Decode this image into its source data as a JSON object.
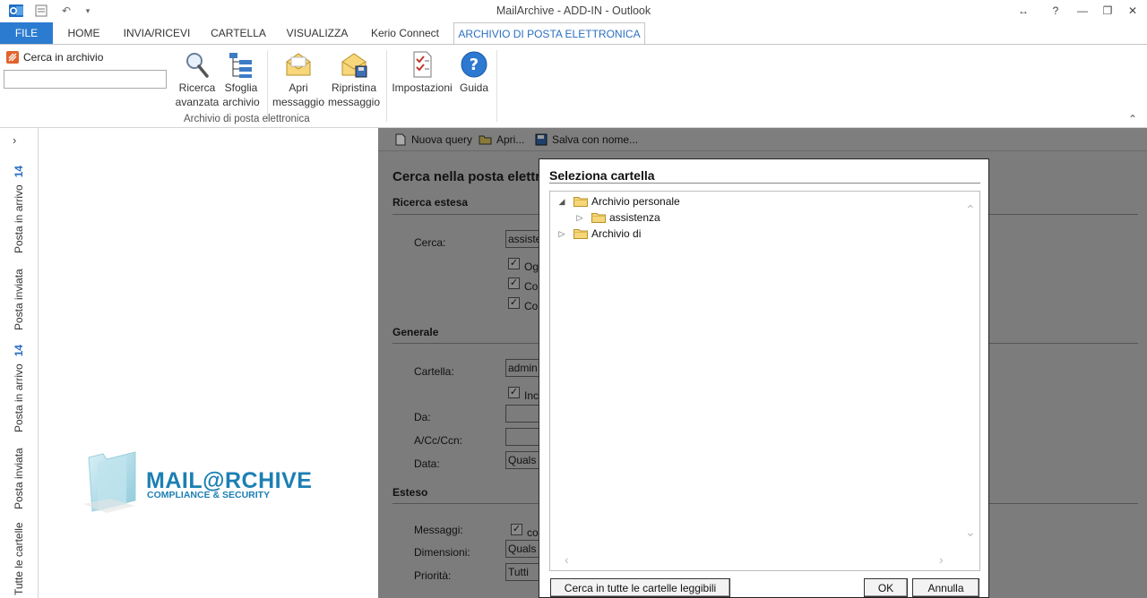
{
  "window": {
    "title": "MailArchive - ADD-IN - Outlook"
  },
  "tabs": [
    {
      "label": "FILE"
    },
    {
      "label": "HOME"
    },
    {
      "label": "INVIA/RICEVI"
    },
    {
      "label": "CARTELLA"
    },
    {
      "label": "VISUALIZZA"
    },
    {
      "label": "Kerio Connect"
    },
    {
      "label": "ARCHIVIO DI POSTA ELETTRONICA"
    }
  ],
  "ribbon": {
    "search_label": "Cerca in archivio",
    "search_value": "",
    "buttons": [
      {
        "line1": "Ricerca",
        "line2": "avanzata"
      },
      {
        "line1": "Sfoglia",
        "line2": "archivio"
      },
      {
        "line1": "Apri",
        "line2": "messaggio"
      },
      {
        "line1": "Ripristina",
        "line2": "messaggio"
      },
      {
        "line1": "Impostazioni",
        "line2": ""
      },
      {
        "line1": "Guida",
        "line2": ""
      }
    ],
    "group_label": "Archivio di posta elettronica"
  },
  "leftnav": {
    "items": [
      {
        "label": "Posta in arrivo",
        "count": "14"
      },
      {
        "label": "Posta inviata",
        "count": ""
      },
      {
        "label": "Posta in arrivo",
        "count": "14"
      },
      {
        "label": "Posta inviata",
        "count": ""
      },
      {
        "label": "Tutte le cartelle",
        "count": ""
      }
    ]
  },
  "logo": {
    "main": "MAIL@RCHIVE",
    "sub": "COMPLIANCE & SECURITY"
  },
  "search_pane": {
    "toolbar": {
      "new_query": "Nuova query",
      "open": "Apri...",
      "save_as": "Salva con nome..."
    },
    "title": "Cerca nella posta elettr",
    "sections": {
      "extended_search": "Ricerca estesa",
      "general": "Generale",
      "extended": "Esteso"
    },
    "fields": {
      "search_label": "Cerca:",
      "search_value": "assiste",
      "check1": "Og",
      "check2": "Co",
      "check3": "Co",
      "folder_label": "Cartella:",
      "folder_value": "admin",
      "include_check": "Inc",
      "from_label": "Da:",
      "to_label": "A/Cc/Ccn:",
      "date_label": "Data:",
      "date_value": "Quals",
      "messages_label": "Messaggi:",
      "messages_check": "co",
      "size_label": "Dimensioni:",
      "size_value": "Quals",
      "priority_label": "Priorità:",
      "priority_value": "Tutti"
    }
  },
  "dialog": {
    "title": "Seleziona cartella",
    "tree": [
      {
        "label": "Archivio personale",
        "expanded": true,
        "level": 0
      },
      {
        "label": "assistenza",
        "expanded": false,
        "level": 1
      },
      {
        "label": "Archivio di",
        "expanded": false,
        "level": 0
      }
    ],
    "buttons": {
      "search_all": "Cerca in tutte le cartelle leggibili",
      "ok": "OK",
      "cancel": "Annulla"
    }
  },
  "colors": {
    "accent": "#2b7bd1",
    "tab_active_text": "#2b6fc0",
    "dim_overlay": "#7c7c7c"
  }
}
